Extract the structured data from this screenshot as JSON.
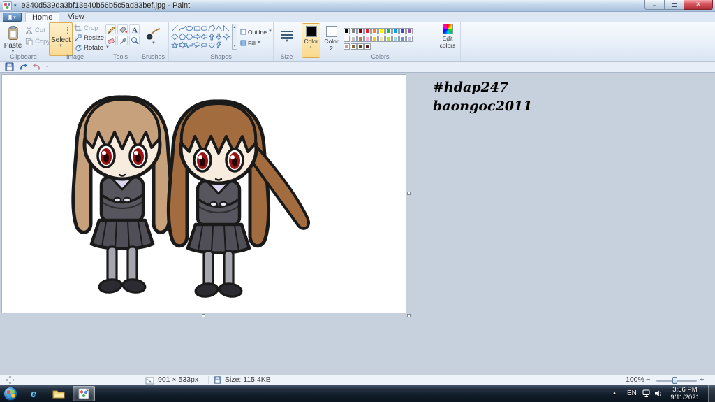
{
  "window": {
    "title": "e340d539da3bf13e40b56b5c5ad83bef.jpg - Paint"
  },
  "tabs": {
    "home": "Home",
    "view": "View"
  },
  "ribbon": {
    "clipboard": {
      "label": "Clipboard",
      "paste": "Paste",
      "cut": "Cut",
      "copy": "Copy"
    },
    "image": {
      "label": "Image",
      "select": "Select",
      "crop": "Crop",
      "resize": "Resize",
      "rotate": "Rotate"
    },
    "tools": {
      "label": "Tools"
    },
    "brushes": {
      "label": "Brushes"
    },
    "shapes": {
      "label": "Shapes",
      "outline": "Outline",
      "fill": "Fill",
      "items": [
        "line",
        "curve",
        "oval",
        "rectangle",
        "rounded-rectangle",
        "polygon",
        "triangle",
        "right-triangle",
        "diamond",
        "pentagon",
        "hexagon",
        "arrow-right",
        "arrow-left",
        "arrow-up",
        "arrow-down",
        "star-4",
        "star-5",
        "star-6",
        "callout-rounded",
        "callout-oval",
        "callout-cloud",
        "heart",
        "lightning"
      ]
    },
    "size": {
      "label": "Size"
    },
    "colors": {
      "label": "Colors",
      "color1": {
        "label_line1": "Color",
        "label_line2": "1",
        "value": "#000000"
      },
      "color2": {
        "label_line1": "Color",
        "label_line2": "2",
        "value": "#ffffff"
      },
      "edit": {
        "label_line1": "Edit",
        "label_line2": "colors"
      },
      "palette": [
        [
          "#000000",
          "#7f7f7f",
          "#880015",
          "#ed1c24",
          "#ff7f27",
          "#fff200",
          "#22b14c",
          "#00a2e8",
          "#3f48cc",
          "#a349a4"
        ],
        [
          "#ffffff",
          "#c3c3c3",
          "#b97a57",
          "#ffaec9",
          "#ffc90e",
          "#efe4b0",
          "#b5e61d",
          "#99d9ea",
          "#7092be",
          "#c8bfe7"
        ],
        [
          "#b9a58c",
          "#8c6239",
          "#5d3a1a",
          "#5c1f24",
          "",
          "",
          "",
          "",
          "",
          ""
        ]
      ]
    }
  },
  "canvas": {
    "annotation": {
      "line1": "#hdap247",
      "line2": "baongoc2011"
    }
  },
  "artwork_colors": {
    "hair-left": "#c7a07c",
    "hair-right": "#a26c3e",
    "skin": "#f8ecdf",
    "uniform": "#57565e",
    "skirt": "#504f57",
    "collar": "#ddd6ef",
    "stocking": "#a5a5ae",
    "shoe": "#2b2b31",
    "eye": "#9c1313",
    "pupil": "#260404",
    "ink": "#1a1a1a"
  },
  "statusbar": {
    "canvas_size": "901 × 533px",
    "file_size": "Size: 115.4KB",
    "zoom": "100%"
  },
  "taskbar": {
    "language": "EN",
    "time": "3:56 PM",
    "date": "9/11/2021"
  }
}
